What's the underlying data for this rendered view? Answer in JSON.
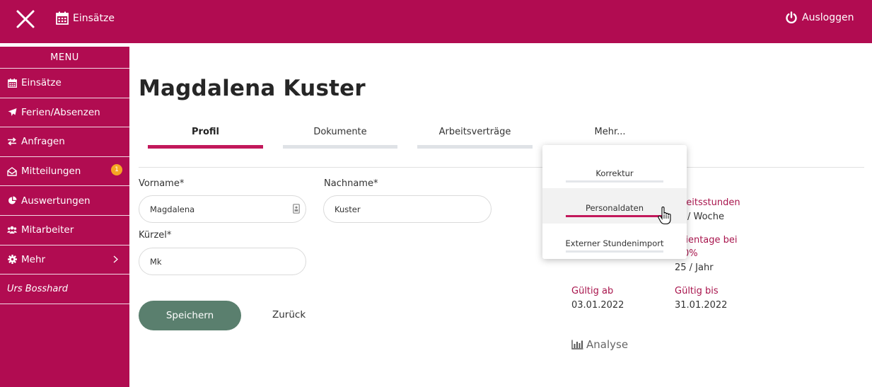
{
  "topbar": {
    "einsaetze_label": "Einsätze",
    "logout_label": "Ausloggen",
    "bg_color": "#b10c51"
  },
  "sidebar": {
    "title": "MENU",
    "items": [
      {
        "label": "Einsätze",
        "icon": "calendar-icon"
      },
      {
        "label": "Ferien/Absenzen",
        "icon": "plane-icon"
      },
      {
        "label": "Anfragen",
        "icon": "exchange-icon"
      },
      {
        "label": "Mitteilungen",
        "icon": "envelope-open-icon",
        "badge": "1"
      },
      {
        "label": "Auswertungen",
        "icon": "pie-chart-icon"
      },
      {
        "label": "Mitarbeiter",
        "icon": "users-icon"
      },
      {
        "label": "Mehr",
        "icon": "gear-icon"
      }
    ],
    "user": "Urs Bosshard"
  },
  "page": {
    "title": "Magdalena Kuster"
  },
  "tabs": [
    {
      "label": "Profil",
      "active": true
    },
    {
      "label": "Dokumente"
    },
    {
      "label": "Arbeitsverträge"
    },
    {
      "label": "Mehr..."
    }
  ],
  "dropdown": {
    "items": [
      {
        "label": "Korrektur"
      },
      {
        "label": "Personaldaten",
        "hover": true
      },
      {
        "label": "Externer Stundenimport"
      }
    ]
  },
  "form": {
    "vorname_label": "Vorname*",
    "vorname_value": "Magdalena",
    "nachname_label": "Nachname*",
    "nachname_value": "Kuster",
    "kuerzel_label": "Kürzel*",
    "kuerzel_value": "Mk",
    "save_label": "Speichern",
    "back_label": "Zurück"
  },
  "contract": {
    "arbeitsstunden_label": "beitsstunden",
    "arbeitsstunden_value": "/ Woche",
    "ferientage_label_1": "rientage bei",
    "ferientage_label_2": "0%",
    "ferientage_value": "25 / Jahr",
    "gueltig_ab_label": "Gültig ab",
    "gueltig_ab_value": "03.01.2022",
    "gueltig_bis_label": "Gültig bis",
    "gueltig_bis_value": "31.01.2022",
    "analyse_label": "Analyse"
  }
}
